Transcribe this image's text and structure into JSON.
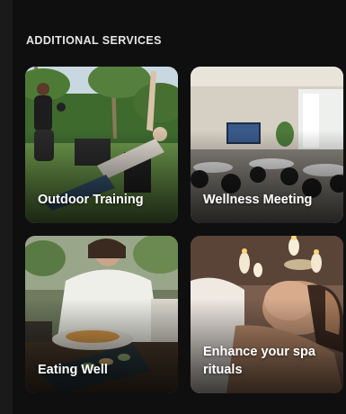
{
  "section": {
    "title": "ADDITIONAL SERVICES"
  },
  "services": [
    {
      "label": "Outdoor Training"
    },
    {
      "label": "Wellness Meeting"
    },
    {
      "label": "Eating Well"
    },
    {
      "label": "Enhance your spa rituals"
    }
  ],
  "colors": {
    "background": "#0f0f10",
    "text": "#ffffff",
    "title": "#e6e6e6"
  }
}
